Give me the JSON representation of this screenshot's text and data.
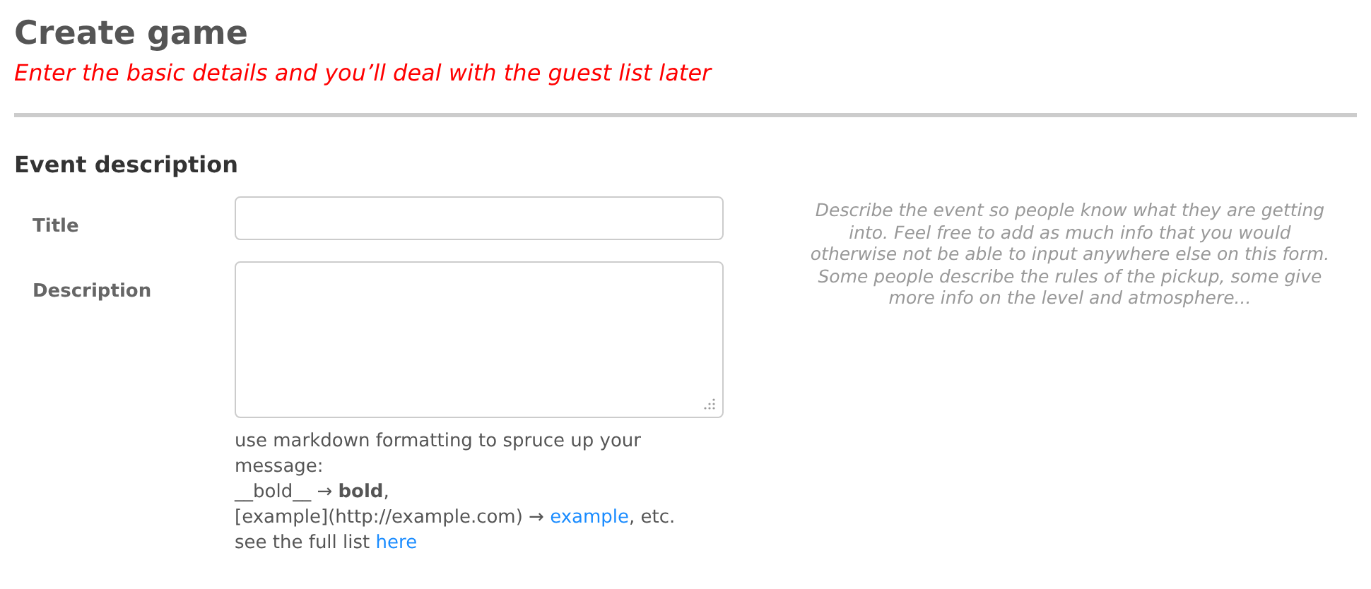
{
  "header": {
    "title": "Create game",
    "subtitle": "Enter the basic details and you’ll deal with the guest list later"
  },
  "section": {
    "title": "Event description",
    "fields": [
      {
        "kind": "input",
        "label": "Title"
      },
      {
        "kind": "textarea",
        "label": "Description"
      }
    ],
    "help": [
      {
        "text": "use markdown formatting to spruce up your message:"
      },
      {
        "text": "__bold__ → **bold**,"
      },
      {
        "text": "[example](http://example.com) → ",
        "link": "example",
        "after": ", etc."
      },
      {
        "text": "see the full list ",
        "link": "here"
      }
    ],
    "note": "Describe the event so people know what they are getting into. Feel free to add as much info that you would otherwise not be able to input anywhere else on this form. Some people describe the rules of the pickup, some give more info on the level and atmosphere..."
  }
}
